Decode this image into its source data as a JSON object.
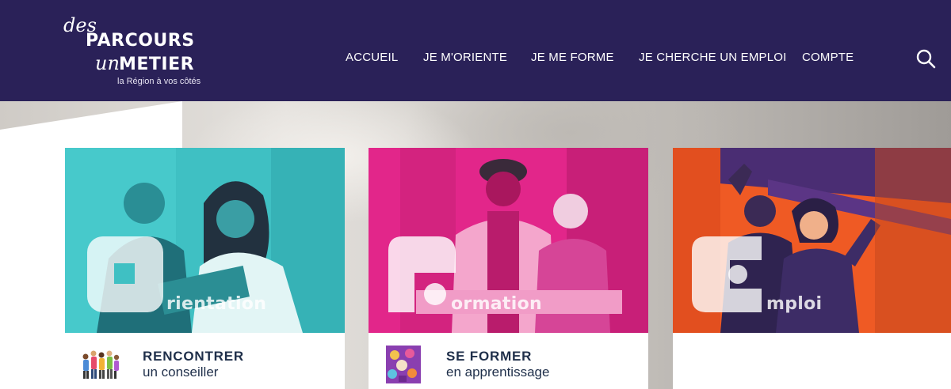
{
  "logo": {
    "line1_script": "des",
    "line1_bold": "PARCOURS",
    "line2_script": "un",
    "line2_bold": "METIER",
    "tagline": "la Région à vos côtés"
  },
  "nav": {
    "items": [
      {
        "label": "ACCUEIL"
      },
      {
        "label": "JE M'ORIENTE"
      },
      {
        "label": "JE ME FORME"
      },
      {
        "label": "JE CHERCHE UN EMPLOI"
      },
      {
        "label": "COMPTE"
      }
    ],
    "search_icon": "search-icon"
  },
  "colors": {
    "header_bg": "#2a2158",
    "orientation": "#3fc0c3",
    "formation": "#e2268a",
    "emploi": "#ef5a24",
    "text_dark": "#1f2f4a"
  },
  "cards": [
    {
      "word": "rientation",
      "cta_title": "RENCONTRER",
      "cta_sub": "un conseiller",
      "icon": "people-group-icon"
    },
    {
      "word": "ormation",
      "cta_title": "SE FORMER",
      "cta_sub": "en apprentissage",
      "icon": "apprentices-collage-icon"
    },
    {
      "word": "mploi",
      "cta_title": "",
      "cta_sub": "",
      "icon": ""
    }
  ]
}
